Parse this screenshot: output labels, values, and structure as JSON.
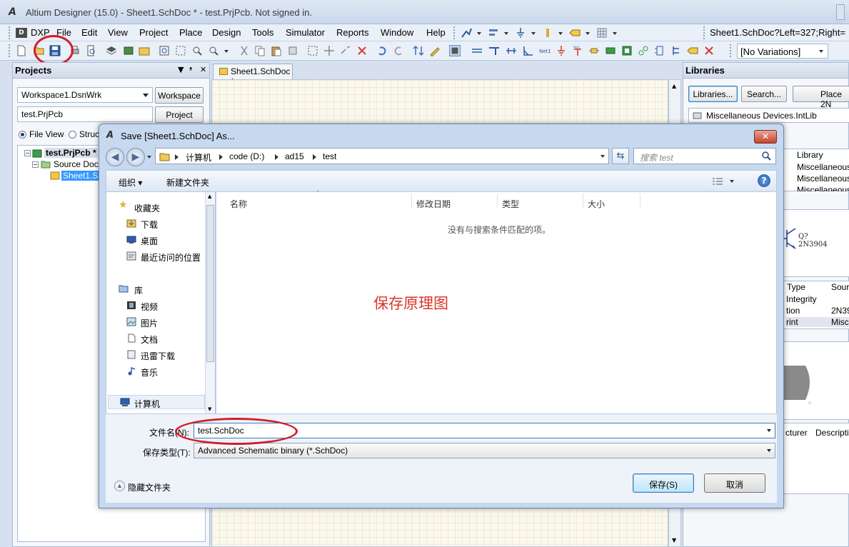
{
  "window": {
    "title": "Altium Designer (15.0) - Sheet1.SchDoc * - test.PrjPcb. Not signed in."
  },
  "menubar": {
    "items": [
      "DXP",
      "File",
      "Edit",
      "View",
      "Project",
      "Place",
      "Design",
      "Tools",
      "Simulator",
      "Reports",
      "Window",
      "Help"
    ],
    "address": "Sheet1.SchDoc?Left=327;Right="
  },
  "toolbar": {
    "variations": "[No Variations]"
  },
  "projects_panel": {
    "title": "Projects",
    "workspace_combo": "Workspace1.DsnWrk",
    "workspace_button": "Workspace",
    "project_field": "test.PrjPcb",
    "project_button": "Project",
    "radio_file_view": "File View",
    "radio_structure": "Struc",
    "tree": {
      "project": "test.PrjPcb *",
      "folder": "Source Docu",
      "document": "Sheet1.Sch"
    }
  },
  "document_tab": "Sheet1.SchDoc *",
  "libraries_panel": {
    "title": "Libraries",
    "libraries_button": "Libraries...",
    "search_button": "Search...",
    "place_button": "Place 2N",
    "current_lib": "Miscellaneous Devices.IntLib",
    "col_library": "Library",
    "lib_rows": [
      "Miscellaneous",
      "Miscellaneous",
      "Miscellaneous"
    ],
    "preview_ref": "Q?",
    "preview_part": "2N3904",
    "model_headers": [
      "Type",
      "Sour"
    ],
    "model_rows": [
      [
        "Integrity",
        ""
      ],
      [
        "tion",
        "2N39"
      ],
      [
        "rint",
        "Misce"
      ]
    ],
    "supplier_headers": [
      "cturer",
      "Descriptio"
    ]
  },
  "dialog": {
    "title": "Save [Sheet1.SchDoc] As...",
    "breadcrumb": [
      "计算机",
      "code (D:)",
      "ad15",
      "test"
    ],
    "search_placeholder": "搜索 test",
    "organize": "组织 ▾",
    "new_folder": "新建文件夹",
    "nav": {
      "favorites": "收藏夹",
      "downloads": "下载",
      "desktop": "桌面",
      "recent": "最近访问的位置",
      "libraries": "库",
      "videos": "视频",
      "pictures": "图片",
      "documents": "文档",
      "xunlei": "迅雷下载",
      "music": "音乐",
      "computer": "计算机"
    },
    "columns": [
      "名称",
      "修改日期",
      "类型",
      "大小"
    ],
    "empty_message": "没有与搜索条件匹配的项。",
    "annotation": "保存原理图",
    "filename_label": "文件名(N):",
    "filename_value": "test.SchDoc",
    "filetype_label": "保存类型(T):",
    "filetype_value": "Advanced Schematic binary (*.SchDoc)",
    "hide_folders": "隐藏文件夹",
    "save_button": "保存(S)",
    "cancel_button": "取消"
  },
  "colors": {
    "highlight_circle": "#d21e2a",
    "annotation_text": "#d7362a",
    "selection": "#3399ff"
  }
}
